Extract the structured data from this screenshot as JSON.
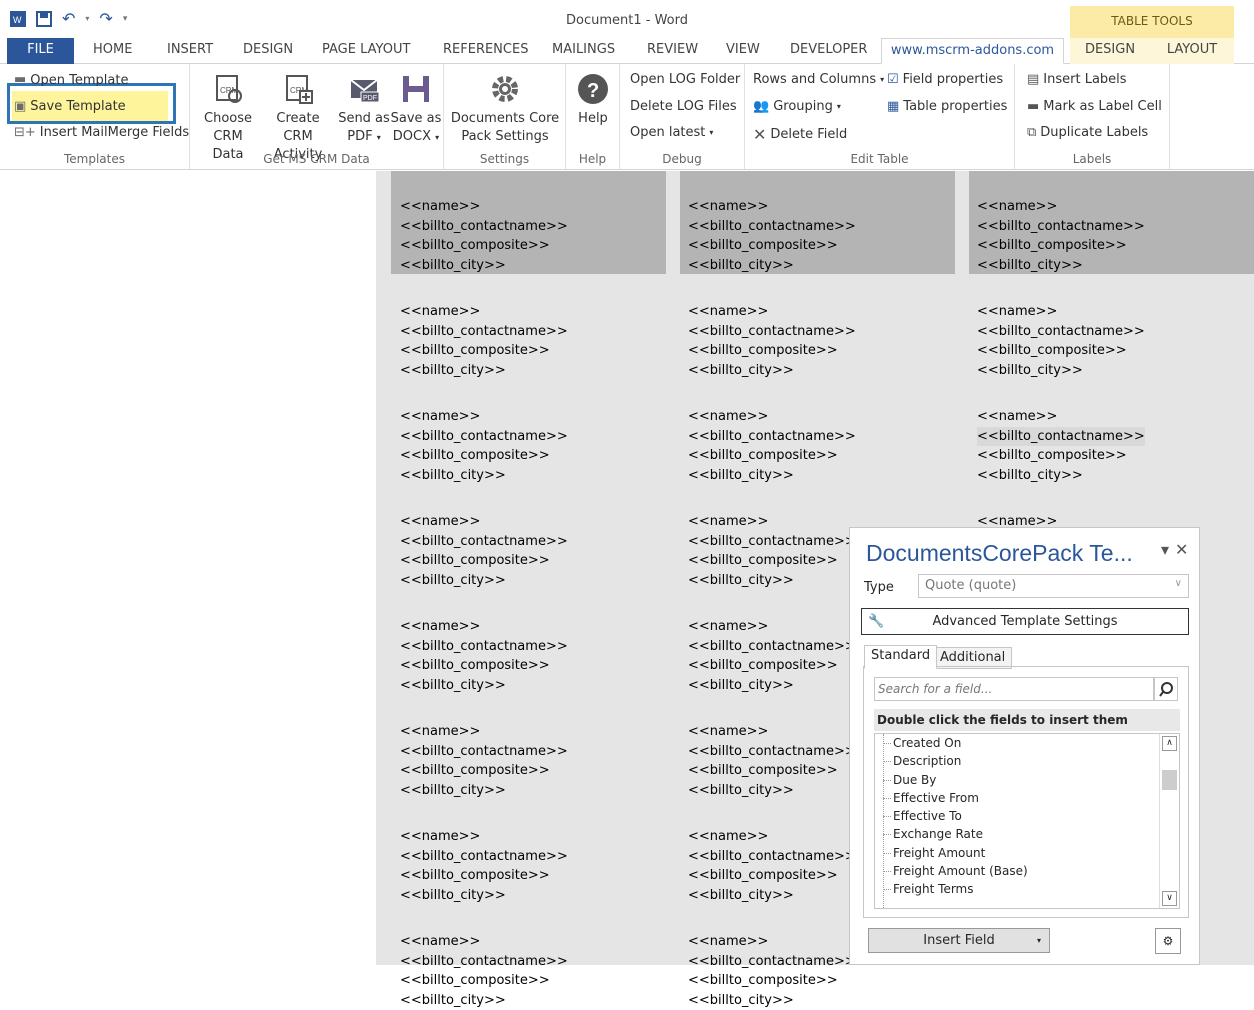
{
  "window": {
    "title": "Document1 - Word",
    "context_header": "TABLE TOOLS"
  },
  "tabs": {
    "file": "FILE",
    "home": "HOME",
    "insert": "INSERT",
    "design": "DESIGN",
    "page_layout": "PAGE LAYOUT",
    "references": "REFERENCES",
    "mailings": "MAILINGS",
    "review": "REVIEW",
    "view": "VIEW",
    "developer": "DEVELOPER",
    "addon": "www.mscrm-addons.com",
    "ctx_design": "DESIGN",
    "ctx_layout": "LAYOUT"
  },
  "ribbon": {
    "templates": {
      "open": "Open Template",
      "save": "Save Template",
      "insert_fields": "Insert MailMerge Fields",
      "label": "Templates"
    },
    "crm": {
      "choose1": "Choose",
      "choose2": "CRM Data",
      "create1": "Create CRM",
      "create2": "Activity",
      "send1": "Send as",
      "send2": "PDF",
      "save1": "Save as",
      "save2": "DOCX",
      "label": "Get MS CRM Data"
    },
    "settings": {
      "btn1": "Documents Core",
      "btn2": "Pack Settings",
      "label": "Settings"
    },
    "help": {
      "btn": "Help",
      "label": "Help"
    },
    "debug": {
      "open_log": "Open LOG Folder",
      "delete_log": "Delete LOG Files",
      "open_latest": "Open latest",
      "label": "Debug"
    },
    "edit_table": {
      "rows_cols": "Rows and Columns",
      "grouping": "Grouping",
      "delete_field": "Delete Field",
      "field_props": "Field properties",
      "table_props": "Table properties",
      "label": "Edit Table"
    },
    "labels": {
      "insert": "Insert Labels",
      "mark": "Mark as Label Cell",
      "duplicate": "Duplicate Labels",
      "label": "Labels"
    }
  },
  "label_fields": [
    "<<name>>",
    "<<billto_contactname>>",
    "<<billto_composite>>",
    "<<billto_city>>"
  ],
  "pane": {
    "title": "DocumentsCorePack Te...",
    "type_label": "Type",
    "type_value": "Quote (quote)",
    "advanced": "Advanced Template Settings",
    "tab_standard": "Standard",
    "tab_additional": "Additional",
    "search_placeholder": "Search for a field...",
    "hint": "Double click the fields to insert them",
    "fields": [
      "Created On",
      "Description",
      "Due By",
      "Effective From",
      "Effective To",
      "Exchange Rate",
      "Freight Amount",
      "Freight Amount (Base)",
      "Freight Terms"
    ],
    "insert_field": "Insert Field"
  },
  "colors": {
    "accent": "#2b579a",
    "highlight": "#fef49c",
    "highlight_border": "#2e75b6",
    "context": "#fbeba7"
  }
}
